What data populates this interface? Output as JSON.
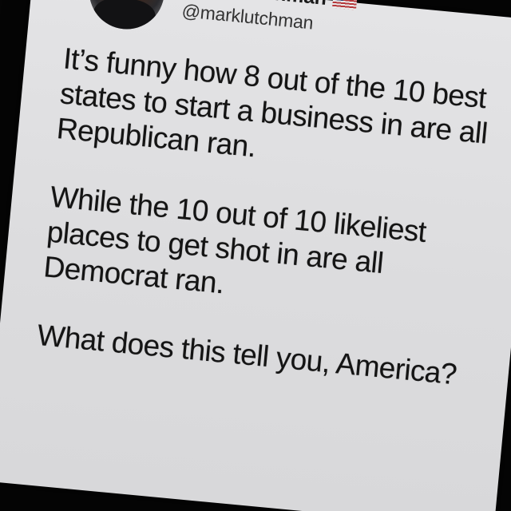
{
  "tweet": {
    "author": {
      "display_name": "Mark Lutchman",
      "handle": "@marklutchman",
      "flag_icon": "us-flag-icon"
    },
    "paragraphs": [
      "It’s funny how 8 out of the 10 best\nstates to start a business in are all\nRepublican ran.",
      "While the 10 out of 10 likeliest\nplaces to get shot in are all\nDemocrat ran.",
      "What does this tell you, America?"
    ]
  },
  "colors": {
    "background": "#050505",
    "card": "#e0e0e2",
    "text": "#141414",
    "handle": "#333333"
  }
}
